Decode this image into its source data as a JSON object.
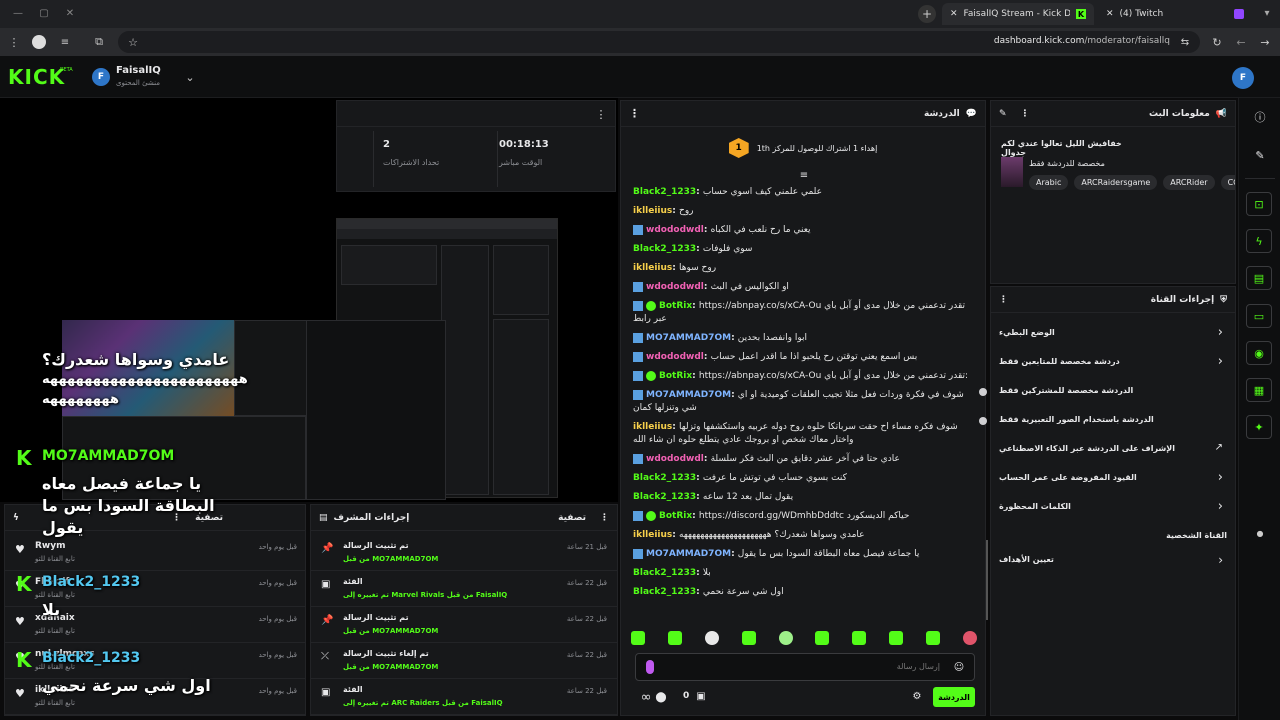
{
  "browser": {
    "tabs": [
      {
        "title": "FaisalIQ Stream - Kick Dashboar"
      },
      {
        "title": "(4) Twitch"
      }
    ],
    "url_host": "dashboard.kick.com",
    "url_path": "/moderator/faisallq"
  },
  "header": {
    "logo": "KICK",
    "logo_badge": "BETA",
    "channel_name": "FaisalIQ",
    "channel_role": "منشئ المحتوى",
    "avatar_letter": "F"
  },
  "stats": {
    "live_time": "00:18:13",
    "live_time_label": "الوقت مباشر",
    "subs_count": "2",
    "subs_label": "تحداد الاشتراكات"
  },
  "chat": {
    "title": "الدردشة",
    "pinned_rank": "1",
    "pinned_text": "إهداء 1 اشتراك للوصول للمركز 1th",
    "messages": [
      {
        "user": "Black2_1233",
        "text": "علمي علمني كيف اسوي حساب",
        "color": "green",
        "icon": false,
        "verified": false
      },
      {
        "user": "iklleiius",
        "text": "روح",
        "color": "yel",
        "icon": false,
        "verified": false
      },
      {
        "user": "wdododwdl",
        "text": "يعني ما رح نلعب في الكباه",
        "color": "pink",
        "icon": true,
        "verified": false
      },
      {
        "user": "Black2_1233",
        "text": "سوي فلوفات",
        "color": "green",
        "icon": false,
        "verified": false
      },
      {
        "user": "iklleiius",
        "text": "روح سوها",
        "color": "yel",
        "icon": false,
        "verified": false
      },
      {
        "user": "wdododwdl",
        "text": "او الكواليس في البث",
        "color": "pink",
        "icon": true,
        "verified": false
      },
      {
        "user": "BotRix",
        "text": "https://abnpay.co/s/xCA-Ou تقدر تدعمني من خلال مدى أو آبل باي عبر رابط",
        "color": "green",
        "icon": true,
        "verified": true
      },
      {
        "user": "MO7AMMAD7OM",
        "text": "ابوا وانفصدا بحدين",
        "color": "blue",
        "icon": true,
        "verified": false
      },
      {
        "user": "wdododwdl",
        "text": "بس اسمع يعني توقتن رح يلحبو اذا ما اقدر اعمل حساب",
        "color": "pink",
        "icon": true,
        "verified": false
      },
      {
        "user": "BotRix",
        "text": "https://abnpay.co/s/xCA-Ou تقدر تدعمني من خلال مدى أو آبل باي:",
        "color": "green",
        "icon": true,
        "verified": true
      },
      {
        "user": "MO7AMMAD7OM",
        "text": "شوف في فكرة وردات فعل مثلا تجيب العلقات كوميدية او اي شي وتنزلها كمان",
        "color": "blue",
        "icon": true,
        "verified": false
      },
      {
        "user": "iklleiius",
        "text": "شوف فكره مساء اح حقت سرباتكا حلوه روح دوله عربيه واستكشفها وتزلها واختار معاك شخص او بروجك عادي يتطلع حلوه ان شاء الله",
        "color": "yel",
        "icon": false,
        "verified": false
      },
      {
        "user": "wdododwdl",
        "text": "عادي حتا في آخر عشر دقايق من البث فكر سلسلة",
        "color": "pink",
        "icon": true,
        "verified": false
      },
      {
        "user": "Black2_1233",
        "text": "كنت بسوي حساب في توتش ما عرفت",
        "color": "green",
        "icon": false,
        "verified": false
      },
      {
        "user": "Black2_1233",
        "text": "يقول تمال بعد 12 ساعه",
        "color": "green",
        "icon": false,
        "verified": false
      },
      {
        "user": "BotRix",
        "text": "https://discord.gg/WDmhbDddtc حياكم الديسكورد",
        "color": "green",
        "icon": true,
        "verified": true
      },
      {
        "user": "iklleiius",
        "text": "عامدي وسواها شعدرك؟ هههههههههههههههههههههه",
        "color": "yel",
        "icon": false,
        "verified": false
      },
      {
        "user": "MO7AMMAD7OM",
        "text": "يا جماعة فيصل معاه البطاقة السودا بس ما يقول",
        "color": "blue",
        "icon": true,
        "verified": false
      },
      {
        "user": "Black2_1233",
        "text": "بلا",
        "color": "green",
        "icon": false,
        "verified": false
      },
      {
        "user": "Black2_1233",
        "text": "اول شي سرعة نحمي",
        "color": "green",
        "icon": false,
        "verified": false
      }
    ],
    "input_placeholder": "إرسال رسالة",
    "count": "0",
    "send_label": "الدردشة"
  },
  "stream_info": {
    "title": "معلومات البث",
    "stream_title": "خفافيش الليل تعالوا عندي لكم جدوال",
    "category": "مخصصة للدردشة فقط",
    "tags": [
      "Arabic",
      "ARCRaidersgame",
      "ARCRider",
      "CO"
    ]
  },
  "channel_actions": {
    "title": "إجراءات القناة",
    "items": [
      {
        "label": "الوضع البطيء",
        "control": "chevron"
      },
      {
        "label": "دردشة مخصصة للمتابعين فقط",
        "control": "chevron"
      },
      {
        "label": "الدردشة مخصصة للمشتركين فقط",
        "control": "toggle"
      },
      {
        "label": "الدردشة باستخدام الصور التعبيرية فقط",
        "control": "toggle"
      },
      {
        "label": "الإشراف على الدردشة عبر الذكاء الاصطناعي",
        "control": "ext"
      },
      {
        "label": "القيود المفروضة على عمر الحساب",
        "control": "chevron"
      },
      {
        "label": "الكلمات المحظورة",
        "control": "chevron"
      }
    ],
    "personal_title": "القناة الشخصية",
    "goals_label": "تعيين الأهداف"
  },
  "activity": {
    "title": "موجز النشاط",
    "filter_label": "تصفية",
    "items": [
      {
        "user": "Rwym",
        "sub": "تابع القناة للتو",
        "time": "قبل يوم واحد"
      },
      {
        "user": "Fkekdf",
        "sub": "تابع القناة للتو",
        "time": "قبل يوم واحد"
      },
      {
        "user": "xdanaix",
        "sub": "تابع القناة للتو",
        "time": "قبل يوم واحد"
      },
      {
        "user": "nul.zlmcaxs",
        "sub": "تابع القناة للتو",
        "time": "قبل يوم واحد"
      },
      {
        "user": "iklleiius",
        "sub": "تابع القناة للتو",
        "time": "قبل يوم واحد"
      }
    ]
  },
  "mod_actions": {
    "title": "إجراءات المشرف",
    "filter_label": "تصفية",
    "items": [
      {
        "title": "تم تثبيت الرسالة",
        "detail": "من قبل MO7AMMAD7OM",
        "time": "قبل 21 ساعة",
        "icon": "pin"
      },
      {
        "title": "الفئة",
        "detail": "تم تغييره إلى Marvel Rivals من قبل FaisalIQ",
        "time": "قبل 22 ساعة",
        "icon": "category"
      },
      {
        "title": "تم تثبيت الرسالة",
        "detail": "من قبل MO7AMMAD7OM",
        "time": "قبل 22 ساعة",
        "icon": "pin"
      },
      {
        "title": "تم إلغاء تثبيت الرسالة",
        "detail": "من قبل MO7AMMAD7OM",
        "time": "قبل 22 ساعة",
        "icon": "unpin"
      },
      {
        "title": "الفئة",
        "detail": "تم تغييره إلى ARC Raiders من قبل FaisalIQ",
        "time": "قبل 22 ساعة",
        "icon": "category"
      }
    ]
  },
  "overlay": {
    "lines": [
      "عامدي وسواها شعدرك؟",
      "هههههههههههههههههههههههه",
      "ههههههههه",
      "MO7AMMAD7OM",
      "يا جماعة فيصل معاه",
      "البطاقة السودا بس ما",
      "يقول",
      "Black2_1233",
      "بلا",
      "Black2_1233",
      "اول شي سرعة نحمي"
    ]
  }
}
